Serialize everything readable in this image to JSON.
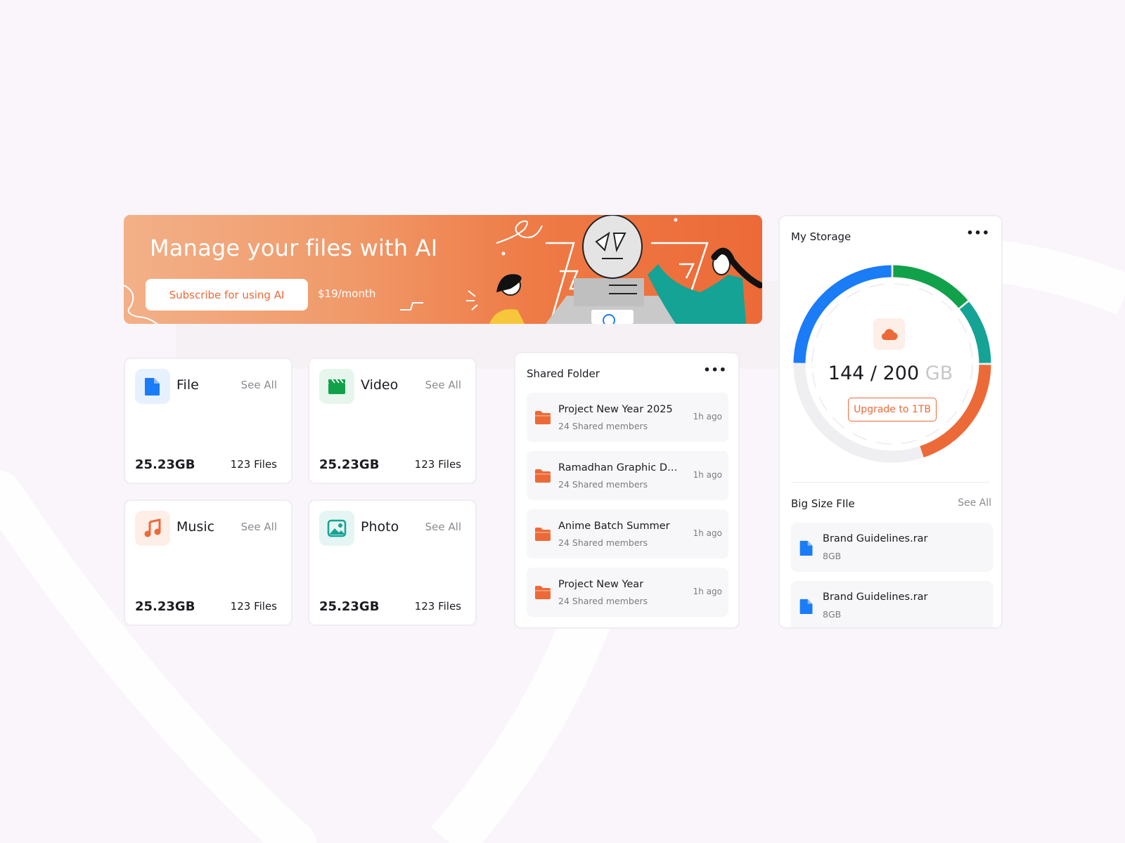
{
  "banner": {
    "title": "Manage your files with AI",
    "subscribe_label": "Subscribe for using AI",
    "price": "$19/month"
  },
  "categories": [
    {
      "name": "File",
      "see_all": "See All",
      "size": "25.23GB",
      "count": "123 Files",
      "icon": "file-icon",
      "color": "#1a7cf6"
    },
    {
      "name": "Video",
      "see_all": "See All",
      "size": "25.23GB",
      "count": "123 Files",
      "icon": "clapperboard-icon",
      "color": "#11a14a"
    },
    {
      "name": "Music",
      "see_all": "See All",
      "size": "25.23GB",
      "count": "123 Files",
      "icon": "music-note-icon",
      "color": "#ec6a38"
    },
    {
      "name": "Photo",
      "see_all": "See All",
      "size": "25.23GB",
      "count": "123 Files",
      "icon": "image-icon",
      "color": "#14a394"
    }
  ],
  "shared_folder": {
    "title": "Shared Folder",
    "menu": "•••",
    "items": [
      {
        "name": "Project New Year 2025",
        "members": "24 Shared members",
        "time": "1h ago"
      },
      {
        "name": "Ramadhan Graphic De...",
        "members": "24 Shared members",
        "time": "1h ago"
      },
      {
        "name": "Anime Batch Summer",
        "members": "24 Shared members",
        "time": "1h ago"
      },
      {
        "name": "Project New Year",
        "members": "24 Shared members",
        "time": "1h ago"
      }
    ]
  },
  "storage": {
    "title": "My Storage",
    "menu": "•••",
    "used": "144",
    "separator": "/",
    "total": "200",
    "unit": "GB",
    "upgrade_label": "Upgrade to 1TB",
    "segments": [
      {
        "name": "orange",
        "color": "#ec6a38",
        "fraction": 0.2
      },
      {
        "name": "teal",
        "color": "#14a394",
        "fraction": 0.11
      },
      {
        "name": "green",
        "color": "#11a14a",
        "fraction": 0.14
      },
      {
        "name": "blue",
        "color": "#1a7cf6",
        "fraction": 0.25
      }
    ],
    "track_color": "#efeff2"
  },
  "big_files": {
    "title": "Big Size FIle",
    "see_all": "See All",
    "items": [
      {
        "name": "Brand Guidelines.rar",
        "size": "8GB"
      },
      {
        "name": "Brand Guidelines.rar",
        "size": "8GB"
      }
    ]
  },
  "colors": {
    "accent": "#ec6a38",
    "background": "#faf5fb"
  }
}
